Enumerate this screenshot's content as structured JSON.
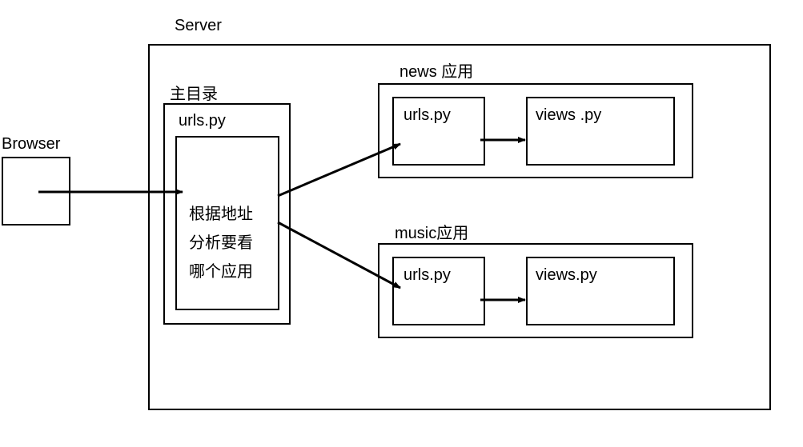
{
  "labels": {
    "browser": "Browser",
    "server": "Server",
    "main_dir": "主目录",
    "urls_py": "urls.py",
    "news_app": "news 应用",
    "music_app": "music应用",
    "views_py": "views .py",
    "views_py2": "views.py"
  },
  "routing": {
    "line1": "根据地址",
    "line2": "分析要看",
    "line3": "哪个应用"
  }
}
